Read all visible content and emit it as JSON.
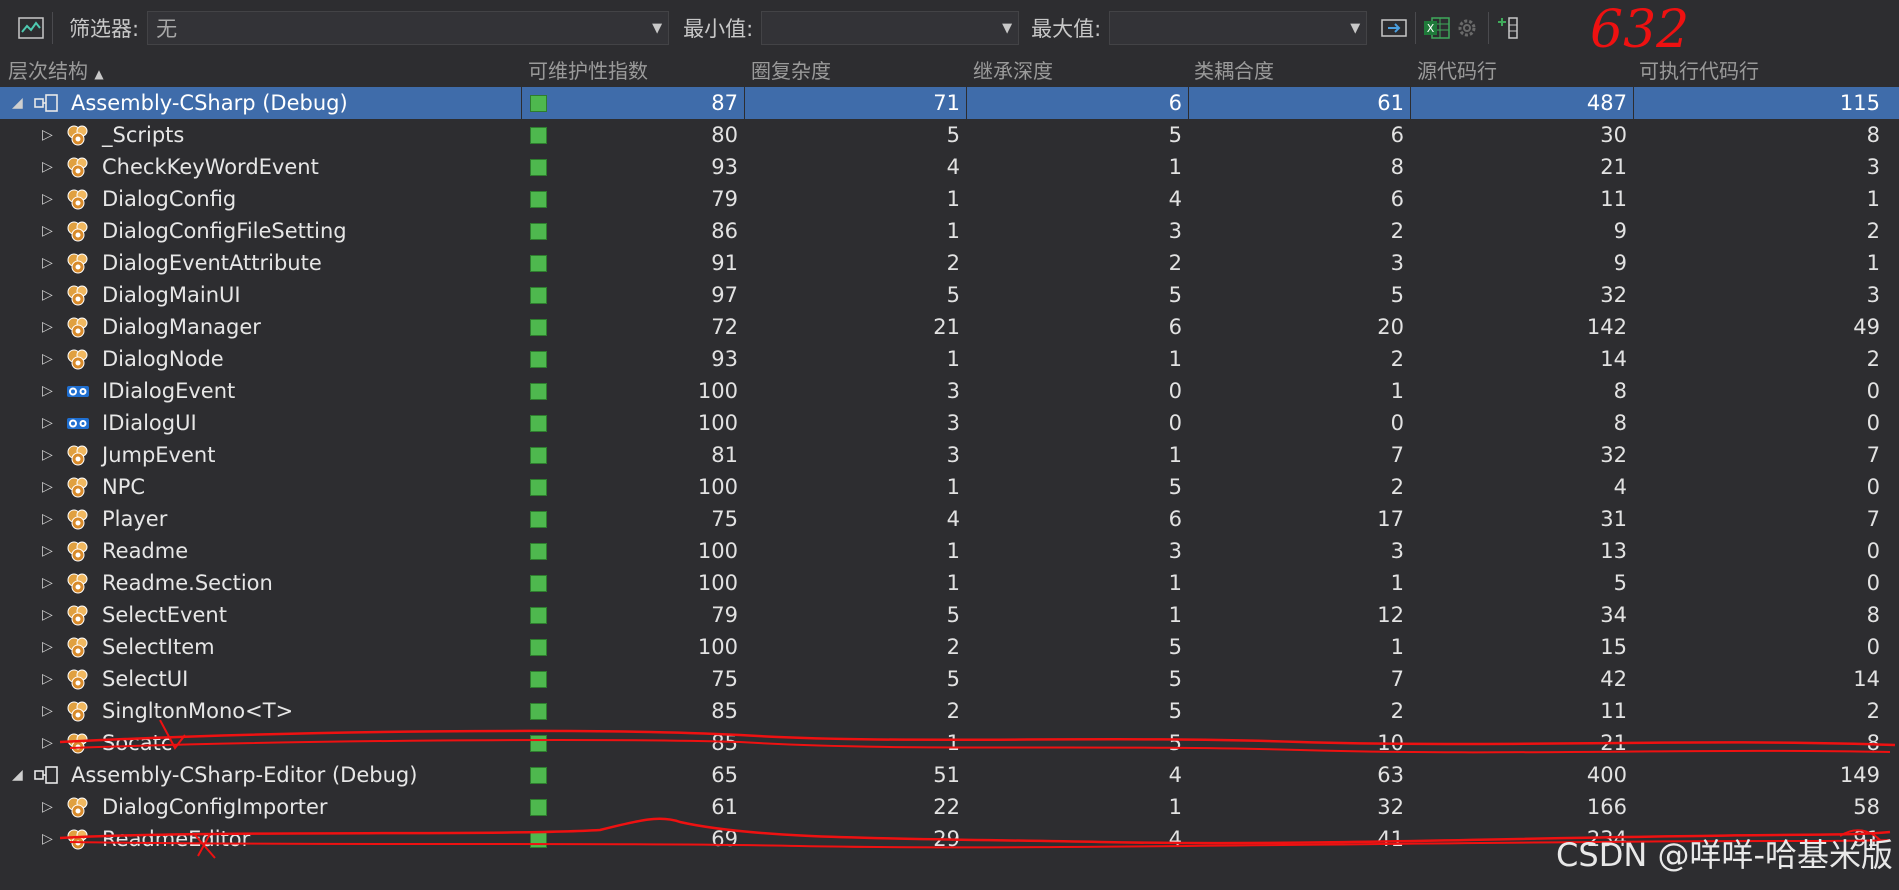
{
  "toolbar": {
    "filter_label": "筛选器:",
    "filter_value": "无",
    "min_label": "最小值:",
    "min_value": "",
    "max_label": "最大值:",
    "max_value": "",
    "annotation": "632",
    "icons": [
      "metrics-chart-icon",
      "apply-filter-icon",
      "excel-export-icon",
      "settings-icon",
      "add-column-icon"
    ]
  },
  "columns": [
    "层次结构",
    "可维护性指数",
    "圈复杂度",
    "继承深度",
    "类耦合度",
    "源代码行",
    "可执行代码行"
  ],
  "sort_indicator": "▲",
  "rows": [
    {
      "name": "Assembly-CSharp (Debug)",
      "level": 0,
      "kind": "assembly",
      "expanded": true,
      "selected": true,
      "values": [
        "87",
        "71",
        "6",
        "61",
        "487",
        "115"
      ]
    },
    {
      "name": "_Scripts",
      "level": 1,
      "kind": "class",
      "values": [
        "80",
        "5",
        "5",
        "6",
        "30",
        "8"
      ]
    },
    {
      "name": "CheckKeyWordEvent",
      "level": 1,
      "kind": "class",
      "values": [
        "93",
        "4",
        "1",
        "8",
        "21",
        "3"
      ]
    },
    {
      "name": "DialogConfig",
      "level": 1,
      "kind": "class",
      "values": [
        "79",
        "1",
        "4",
        "6",
        "11",
        "1"
      ]
    },
    {
      "name": "DialogConfigFileSetting",
      "level": 1,
      "kind": "class",
      "values": [
        "86",
        "1",
        "3",
        "2",
        "9",
        "2"
      ]
    },
    {
      "name": "DialogEventAttribute",
      "level": 1,
      "kind": "class",
      "values": [
        "91",
        "2",
        "2",
        "3",
        "9",
        "1"
      ]
    },
    {
      "name": "DialogMainUI",
      "level": 1,
      "kind": "class",
      "values": [
        "97",
        "5",
        "5",
        "5",
        "32",
        "3"
      ]
    },
    {
      "name": "DialogManager",
      "level": 1,
      "kind": "class",
      "values": [
        "72",
        "21",
        "6",
        "20",
        "142",
        "49"
      ]
    },
    {
      "name": "DialogNode",
      "level": 1,
      "kind": "class",
      "values": [
        "93",
        "1",
        "1",
        "2",
        "14",
        "2"
      ]
    },
    {
      "name": "IDialogEvent",
      "level": 1,
      "kind": "interface",
      "values": [
        "100",
        "3",
        "0",
        "1",
        "8",
        "0"
      ]
    },
    {
      "name": "IDialogUI",
      "level": 1,
      "kind": "interface",
      "values": [
        "100",
        "3",
        "0",
        "0",
        "8",
        "0"
      ]
    },
    {
      "name": "JumpEvent",
      "level": 1,
      "kind": "class",
      "values": [
        "81",
        "3",
        "1",
        "7",
        "32",
        "7"
      ]
    },
    {
      "name": "NPC",
      "level": 1,
      "kind": "class",
      "values": [
        "100",
        "1",
        "5",
        "2",
        "4",
        "0"
      ]
    },
    {
      "name": "Player",
      "level": 1,
      "kind": "class",
      "values": [
        "75",
        "4",
        "6",
        "17",
        "31",
        "7"
      ]
    },
    {
      "name": "Readme",
      "level": 1,
      "kind": "class",
      "values": [
        "100",
        "1",
        "3",
        "3",
        "13",
        "0"
      ]
    },
    {
      "name": "Readme.Section",
      "level": 1,
      "kind": "class",
      "values": [
        "100",
        "1",
        "1",
        "1",
        "5",
        "0"
      ]
    },
    {
      "name": "SelectEvent",
      "level": 1,
      "kind": "class",
      "values": [
        "79",
        "5",
        "1",
        "12",
        "34",
        "8"
      ]
    },
    {
      "name": "SelectItem",
      "level": 1,
      "kind": "class",
      "values": [
        "100",
        "2",
        "5",
        "1",
        "15",
        "0"
      ]
    },
    {
      "name": "SelectUI",
      "level": 1,
      "kind": "class",
      "values": [
        "75",
        "5",
        "5",
        "7",
        "42",
        "14"
      ]
    },
    {
      "name": "SingltonMono<T>",
      "level": 1,
      "kind": "class",
      "values": [
        "85",
        "2",
        "5",
        "2",
        "11",
        "2"
      ]
    },
    {
      "name": "Socatc",
      "level": 1,
      "kind": "class",
      "struck": true,
      "values": [
        "85",
        "1",
        "5",
        "10",
        "21",
        "8"
      ]
    },
    {
      "name": "Assembly-CSharp-Editor (Debug)",
      "level": 0,
      "kind": "assembly",
      "expanded": true,
      "values": [
        "65",
        "51",
        "4",
        "63",
        "400",
        "149"
      ]
    },
    {
      "name": "DialogConfigImporter",
      "level": 1,
      "kind": "class",
      "values": [
        "61",
        "22",
        "1",
        "32",
        "166",
        "58"
      ]
    },
    {
      "name": "ReadmeEditor",
      "level": 1,
      "kind": "class",
      "struck": true,
      "values": [
        "69",
        "29",
        "4",
        "41",
        "234",
        "91"
      ]
    }
  ],
  "watermark": "CSDN @咩咩-哈基米版",
  "colors": {
    "background": "#2d2d30",
    "selection": "#3f6caa",
    "maintainability_good": "#4eb84e",
    "annotation_red": "#e11111"
  }
}
